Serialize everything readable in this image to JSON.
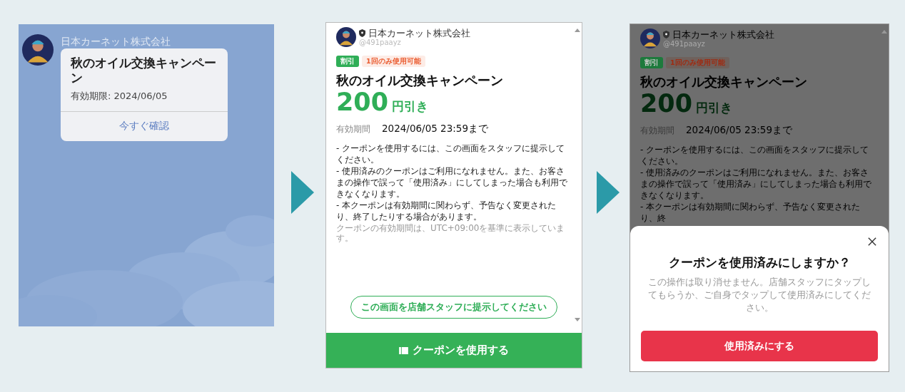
{
  "steps": [
    {
      "kind": "chat",
      "sender": "日本カーネット株式会社",
      "card": {
        "title": "秋のオイル交換キャンペーン",
        "expiry": "有効期限: 2024/06/05",
        "action": "今すぐ確認"
      }
    },
    {
      "kind": "coupon",
      "dimmed": false,
      "account": {
        "name": "日本カーネット株式会社",
        "handle": "@491paayz"
      },
      "tags": [
        {
          "label": "割引",
          "kind": "type"
        },
        {
          "label": "1回のみ使用可能",
          "kind": "limit"
        }
      ],
      "title": "秋のオイル交換キャンペーン",
      "amount": "200",
      "unit": "円引き",
      "period_label": "有効期間",
      "period": "2024/06/05 23:59まで",
      "notes": [
        "- クーポンを使用するには、この画面をスタッフに提示してください。",
        "- 使用済みのクーポンはご利用になれません。また、お客さまの操作で誤って「使用済み」にしてしまった場合も利用できなくなります。",
        "- 本クーポンは有効期間に関わらず、予告なく変更されたり、終了したりする場合があります。"
      ],
      "footnote": "クーポンの有効期間は、UTC+09:00を基準に表示しています。",
      "hint": "この画面を店舗スタッフに提示してください",
      "button": "クーポンを使用する"
    },
    {
      "kind": "coupon",
      "dimmed": true,
      "account": {
        "name": "日本カーネット株式会社",
        "handle": "@491paayz"
      },
      "tags": [
        {
          "label": "割引",
          "kind": "type"
        },
        {
          "label": "1回のみ使用可能",
          "kind": "limit"
        }
      ],
      "title": "秋のオイル交換キャンペーン",
      "amount": "200",
      "unit": "円引き",
      "period_label": "有効期間",
      "period": "2024/06/05 23:59まで",
      "notes": [
        "- クーポンを使用するには、この画面をスタッフに提示してください。",
        "- 使用済みのクーポンはご利用になれません。また、お客さまの操作で誤って「使用済み」にしてしまった場合も利用できなくなります。",
        "- 本クーポンは有効期間に関わらず、予告なく変更されたり、終"
      ],
      "dialog": {
        "title": "クーポンを使用済みにしますか？",
        "message": "この操作は取り消せません。店舗スタッフにタップしてもらうか、ご自身でタップして使用済みにしてください。",
        "button": "使用済みにする"
      }
    }
  ]
}
